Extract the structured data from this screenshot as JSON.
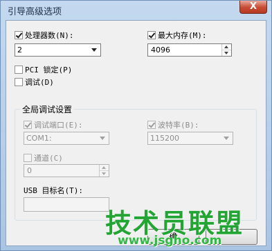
{
  "window": {
    "title": "引导高级选项",
    "close_symbol": "X"
  },
  "processor_count": {
    "label": "处理器数(N):",
    "checked": true,
    "value": "2"
  },
  "max_memory": {
    "label": "最大内存(M):",
    "checked": true,
    "value": "4096"
  },
  "pci_lock": {
    "label": "PCI 锁定(P)",
    "checked": false
  },
  "debug": {
    "label": "调试(D)",
    "checked": false
  },
  "global_debug": {
    "title": "全局调试设置",
    "debug_port": {
      "label": "调试端口(E):",
      "checked": true,
      "value": "COM1:"
    },
    "baud_rate": {
      "label": "波特率(B):",
      "checked": true,
      "value": "115200"
    },
    "channel": {
      "label": "通道(C)",
      "checked": false,
      "value": "0"
    },
    "usb_target": {
      "label": "USB 目标名(T):",
      "value": ""
    }
  },
  "buttons": {
    "ok_partial": "确"
  },
  "watermark": {
    "text": "技术员联盟",
    "url": "www.jsgho.com"
  }
}
